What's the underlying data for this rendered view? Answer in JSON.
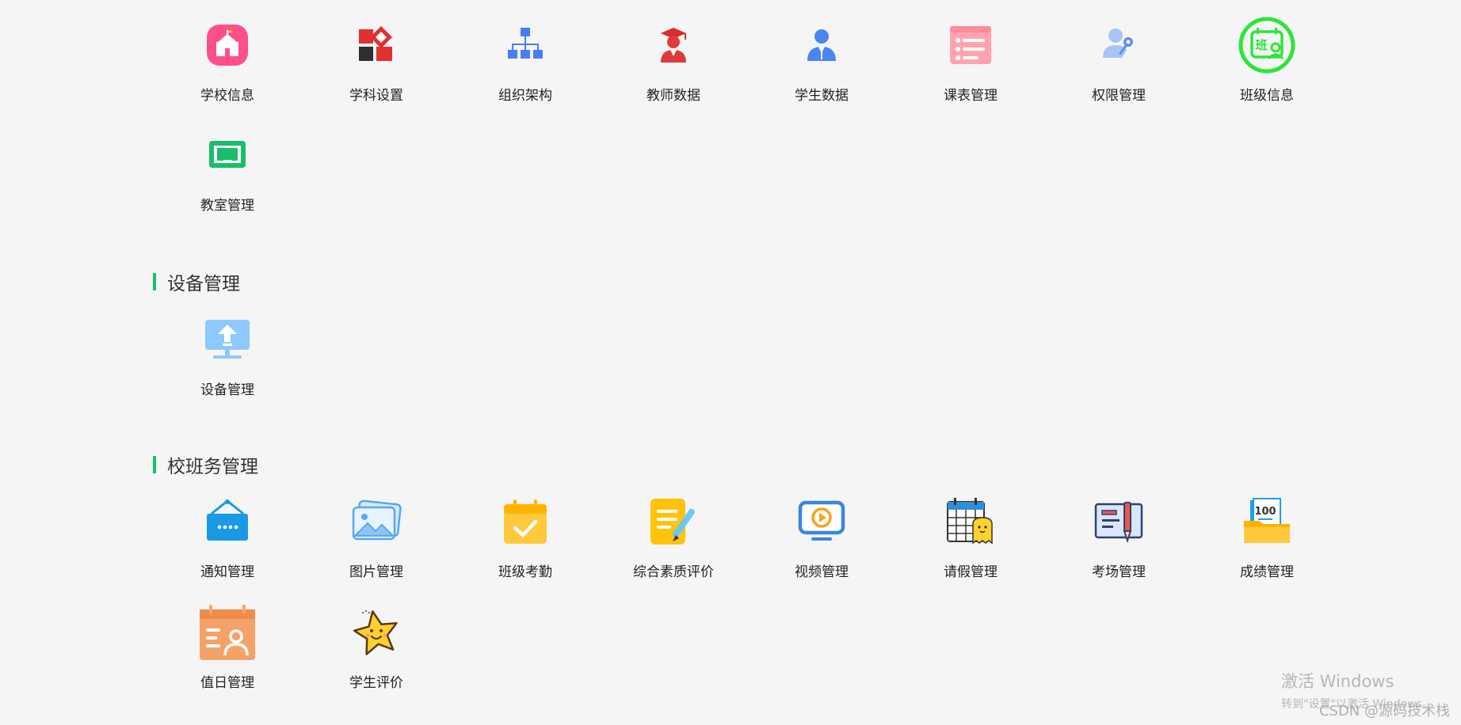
{
  "sections": [
    {
      "title": "",
      "items": [
        {
          "label": "学校信息",
          "icon": "school-icon",
          "color": "#ff4f8b"
        },
        {
          "label": "学科设置",
          "icon": "subject-blocks-icon",
          "color": "#e03030"
        },
        {
          "label": "组织架构",
          "icon": "org-chart-icon",
          "color": "#4a7cf7"
        },
        {
          "label": "教师数据",
          "icon": "teacher-icon",
          "color": "#e03a3a"
        },
        {
          "label": "学生数据",
          "icon": "student-icon",
          "color": "#4a86f0"
        },
        {
          "label": "课表管理",
          "icon": "timetable-icon",
          "color": "#ff9aaa"
        },
        {
          "label": "权限管理",
          "icon": "user-key-icon",
          "color": "#7ba4f5"
        },
        {
          "label": "班级信息",
          "icon": "class-badge-icon",
          "color": "#2ee53a"
        },
        {
          "label": "教室管理",
          "icon": "classroom-board-icon",
          "color": "#19be6b"
        }
      ]
    },
    {
      "title": "设备管理",
      "items": [
        {
          "label": "设备管理",
          "icon": "device-monitor-icon",
          "color": "#8ec8ff"
        }
      ]
    },
    {
      "title": "校班务管理",
      "items": [
        {
          "label": "通知管理",
          "icon": "notice-board-icon",
          "color": "#1a9ae5"
        },
        {
          "label": "图片管理",
          "icon": "picture-icon",
          "color": "#5aa7ea"
        },
        {
          "label": "班级考勤",
          "icon": "attendance-calendar-icon",
          "color": "#ffc93d"
        },
        {
          "label": "综合素质评价",
          "icon": "evaluation-note-icon",
          "color": "#ffc30d"
        },
        {
          "label": "视频管理",
          "icon": "video-play-icon",
          "color": "#3a86e0"
        },
        {
          "label": "请假管理",
          "icon": "leave-calendar-icon",
          "color": "#2f8ed8"
        },
        {
          "label": "考场管理",
          "icon": "exam-room-icon",
          "color": "#4a5fb0"
        },
        {
          "label": "成绩管理",
          "icon": "score-folder-icon",
          "color": "#ffc107"
        },
        {
          "label": "值日管理",
          "icon": "duty-calendar-icon",
          "color": "#f5a26a"
        },
        {
          "label": "学生评价",
          "icon": "star-face-icon",
          "color": "#ffd12e"
        }
      ]
    }
  ],
  "watermarks": {
    "activate_windows": "激活 Windows",
    "activate_hint": "转到\"设置\"以激活 Windows。",
    "csdn": "CSDN @源码技术栈"
  }
}
